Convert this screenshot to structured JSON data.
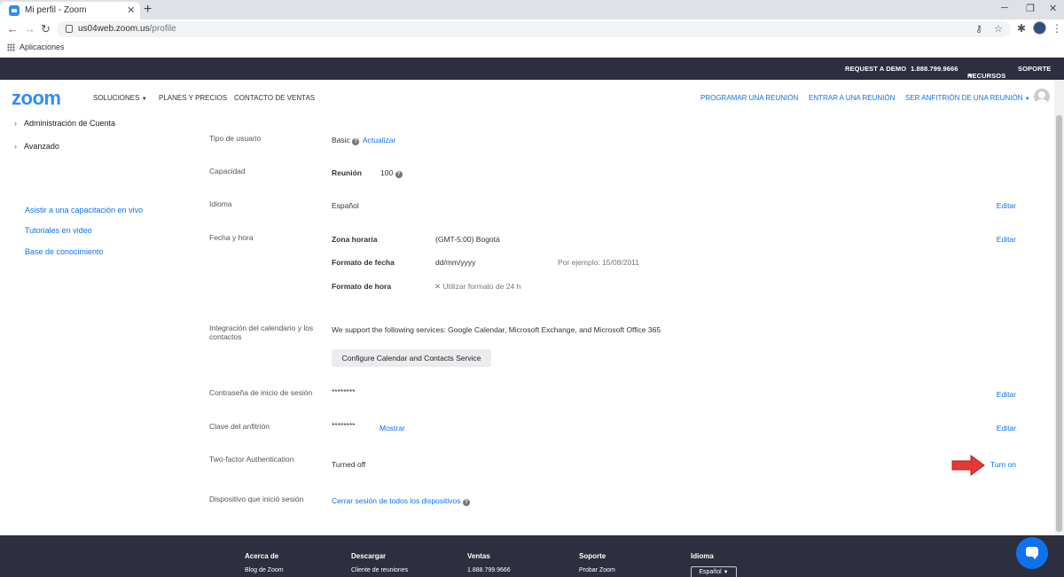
{
  "browser": {
    "tab_title": "Mi perfil - Zoom",
    "url_host": "us04web.zoom.us",
    "url_path": "/profile",
    "bookmark_label": "Aplicaciones"
  },
  "topbar": {
    "request_demo": "REQUEST A DEMO",
    "phone": "1.888.799.9666",
    "resources": "RECURSOS",
    "support": "SOPORTE"
  },
  "nav": {
    "logo": "zoom",
    "solutions": "SOLUCIONES",
    "plans": "PLANES Y PRECIOS",
    "contact_sales": "CONTACTO DE VENTAS",
    "schedule": "PROGRAMAR UNA REUNIÓN",
    "join": "ENTRAR A UNA REUNIÓN",
    "host": "SER ANFITRIÓN DE UNA REUNIÓN"
  },
  "sidebar": {
    "items": [
      {
        "label": "Administración de Cuenta"
      },
      {
        "label": "Avanzado"
      }
    ],
    "links": [
      {
        "label": "Asistir a una capacitación en vivo"
      },
      {
        "label": "Tutoriales en video"
      },
      {
        "label": "Base de conocimiento"
      }
    ]
  },
  "profile": {
    "user_type": {
      "label": "Tipo de usuario",
      "value": "Basic",
      "action": "Actualizar"
    },
    "capacity": {
      "label": "Capacidad",
      "key": "Reunión",
      "value": "100"
    },
    "language": {
      "label": "Idioma",
      "value": "Español",
      "edit": "Editar"
    },
    "datetime": {
      "label": "Fecha y hora",
      "edit": "Editar",
      "tz_key": "Zona horaria",
      "tz_value": "(GMT-5:00) Bogotá",
      "date_key": "Formato de fecha",
      "date_value": "dd/mm/yyyy",
      "date_example": "Por ejemplo:  15/08/2011",
      "time_key": "Formato de hora",
      "time_value": "Utilizar formato de 24 h"
    },
    "calendar": {
      "label": "Integración del calendario y los contactos",
      "text": "We support the following services: Google Calendar, Microsoft Exchange, and Microsoft Office 365",
      "button": "Configure Calendar and Contacts Service"
    },
    "password": {
      "label": "Contraseña de inicio de sesión",
      "value": "********",
      "edit": "Editar"
    },
    "host_key": {
      "label": "Clave del anfitrión",
      "value": "********",
      "show": "Mostrar",
      "edit": "Editar"
    },
    "two_factor": {
      "label": "Two-factor Authentication",
      "value": "Turned off",
      "action": "Turn on"
    },
    "device": {
      "label": "Dispositivo que inició sesión",
      "action": "Cerrar sesión de todos los dispositivos"
    }
  },
  "footer": {
    "columns": [
      {
        "head": "Acerca de",
        "link": "Blog de Zoom"
      },
      {
        "head": "Descargar",
        "link": "Cliente de reuniones"
      },
      {
        "head": "Ventas",
        "link": "1.888.799.9666"
      },
      {
        "head": "Soporte",
        "link": "Probar Zoom"
      },
      {
        "head": "Idioma",
        "link": "Español"
      }
    ]
  },
  "colors": {
    "brand": "#2d8cff",
    "link": "#0e72ed",
    "dark_bar": "#2d2e3f",
    "arrow": "#e53935"
  }
}
